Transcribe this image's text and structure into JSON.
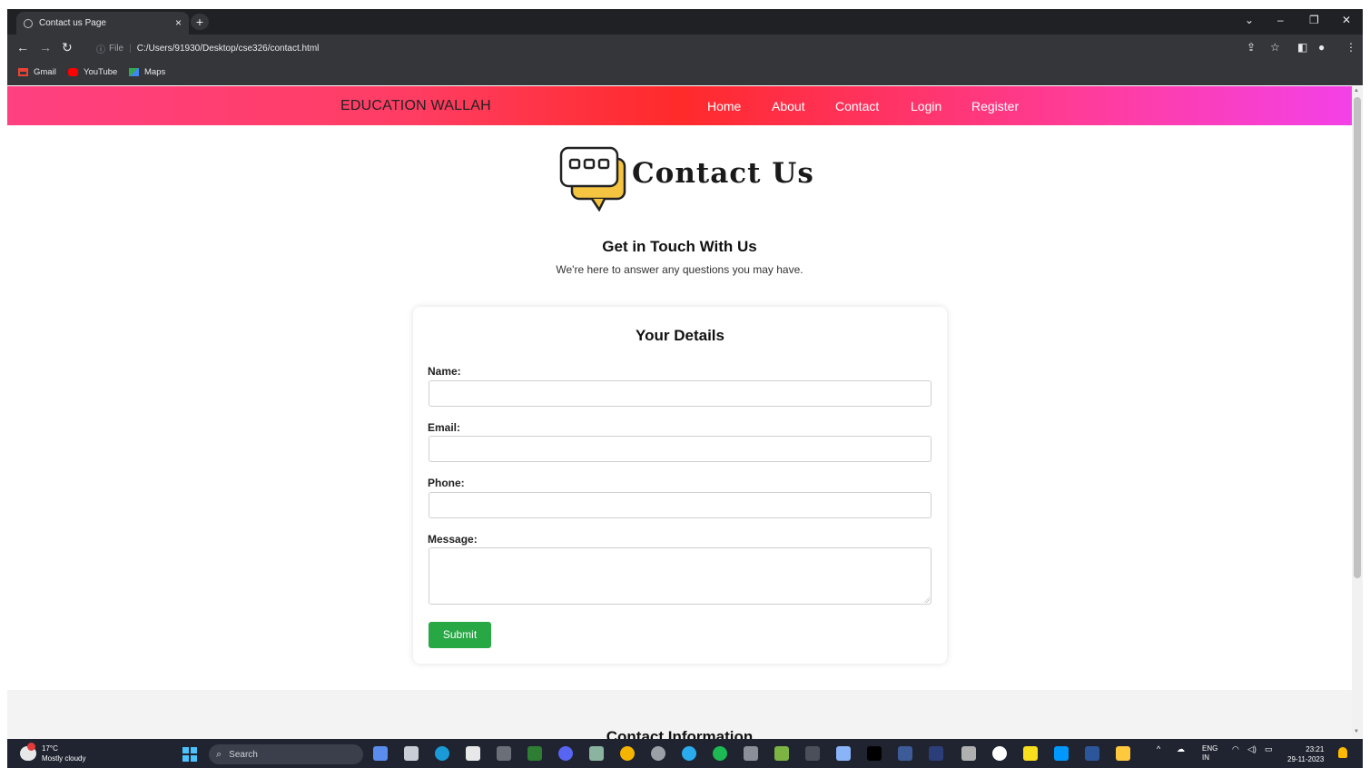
{
  "browser": {
    "tab_title": "Contact us Page",
    "tab_close": "×",
    "new_tab": "+",
    "address_file_label": "File",
    "address_url": "C:/Users/91930/Desktop/cse326/contact.html",
    "bookmarks": [
      {
        "label": "Gmail",
        "icon": "gmail-icon",
        "color": "#ea4335"
      },
      {
        "label": "YouTube",
        "icon": "youtube-icon",
        "color": "#ff0000"
      },
      {
        "label": "Maps",
        "icon": "maps-icon",
        "color": "#34a853"
      }
    ]
  },
  "navbar": {
    "brand": "EDUCATION WALLAH",
    "links": [
      "Home",
      "About",
      "Contact",
      "Login",
      "Register"
    ]
  },
  "hero": {
    "title": "Contact Us",
    "heading": "Get in Touch With Us",
    "subtitle": "We're here to answer any questions you may have."
  },
  "form": {
    "title": "Your Details",
    "name_label": "Name:",
    "email_label": "Email:",
    "phone_label": "Phone:",
    "message_label": "Message:",
    "name_value": "",
    "email_value": "",
    "phone_value": "",
    "message_value": "",
    "submit_label": "Submit",
    "submit_color": "#28a745"
  },
  "info": {
    "title": "Contact Information"
  },
  "taskbar": {
    "weather_temp": "17°C",
    "weather_desc": "Mostly cloudy",
    "search_label": "Search",
    "lang_top": "ENG",
    "lang_bottom": "IN",
    "time": "23:21",
    "date": "29-11-2023"
  },
  "colors": {
    "navbar_gradient_start": "#ff4081",
    "navbar_gradient_mid": "#ff2a2a",
    "navbar_gradient_end": "#f441e8",
    "chrome_dark": "#202124"
  }
}
